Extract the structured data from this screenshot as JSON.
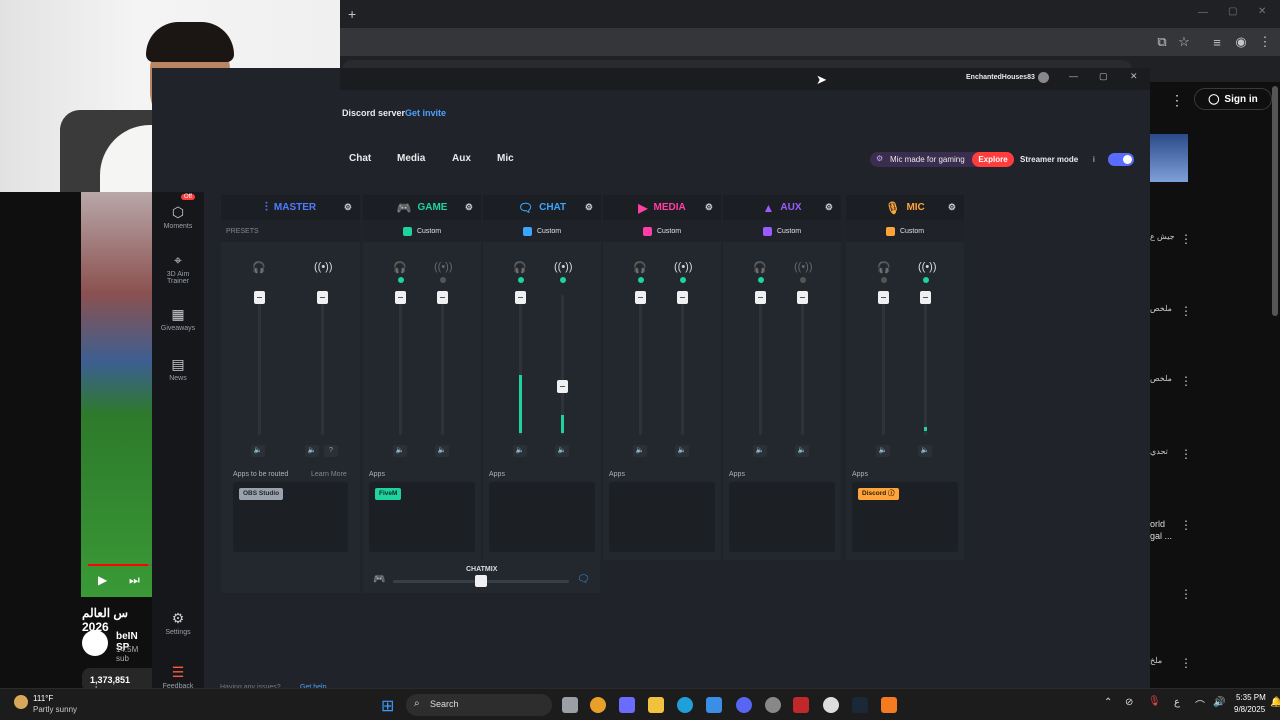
{
  "browser": {
    "new_tab": "+",
    "window_controls": {
      "min": "—",
      "max": "▢",
      "close": "✕"
    },
    "toolbar_icons": [
      "install-icon",
      "star-icon",
      "media-icon",
      "profile-icon",
      "menu-icon"
    ]
  },
  "youtube": {
    "sign_in": "Sign in",
    "video_title": "س العالم 2026",
    "channel_name": "beIN SP",
    "subscribers": "14.5M sub",
    "views": "1,373,851 view",
    "right_items": [
      "جيش ع",
      "ملخص",
      "ملخص",
      "تحدي",
      "orld\ngal ...",
      "ملخ"
    ]
  },
  "app": {
    "title_user": "EnchantedHouses83",
    "discord_text": "Discord server",
    "get_invite": "Get invite",
    "tabs": [
      "Chat",
      "Media",
      "Aux",
      "Mic"
    ],
    "mic_promo": "Mic made for gaming",
    "explore": "Explore",
    "streamer_mode": "Streamer mode",
    "info": "i",
    "sidebar": [
      {
        "label": "Moments",
        "badge": "Off"
      },
      {
        "label": "3D Aim\nTrainer"
      },
      {
        "label": "Giveaways"
      },
      {
        "label": "News"
      },
      {
        "label": "Settings"
      },
      {
        "label": "Feedback"
      }
    ],
    "footer_text": "Having any issues?",
    "footer_link": "Get help",
    "chatmix_label": "CHATMIX",
    "channels": [
      {
        "name": "MASTER",
        "color": "#4f7cff",
        "preset": "PRESETS",
        "apps_label": "Apps to be routed",
        "learn_more": "Learn More",
        "chip": "OBS Studio",
        "chip_color": "#9aa3ad"
      },
      {
        "name": "GAME",
        "color": "#1fd39e",
        "preset": "Custom",
        "apps_label": "Apps",
        "chip": "FiveM",
        "chip_color": "#1fd39e"
      },
      {
        "name": "CHAT",
        "color": "#3aa7ff",
        "preset": "Custom",
        "apps_label": "Apps",
        "chip": ""
      },
      {
        "name": "MEDIA",
        "color": "#ff3fa4",
        "preset": "Custom",
        "apps_label": "Apps",
        "chip": ""
      },
      {
        "name": "AUX",
        "color": "#9b5cff",
        "preset": "Custom",
        "apps_label": "Apps",
        "chip": ""
      },
      {
        "name": "MIC",
        "color": "#ffa43a",
        "preset": "Custom",
        "apps_label": "Apps",
        "chip": "Discord",
        "chip_color": "#ffa43a"
      }
    ]
  },
  "taskbar": {
    "temperature": "111°F",
    "weather": "Partly sunny",
    "search": "Search",
    "time": "5:35 PM",
    "date": "9/8/2025",
    "lang": "ع"
  }
}
